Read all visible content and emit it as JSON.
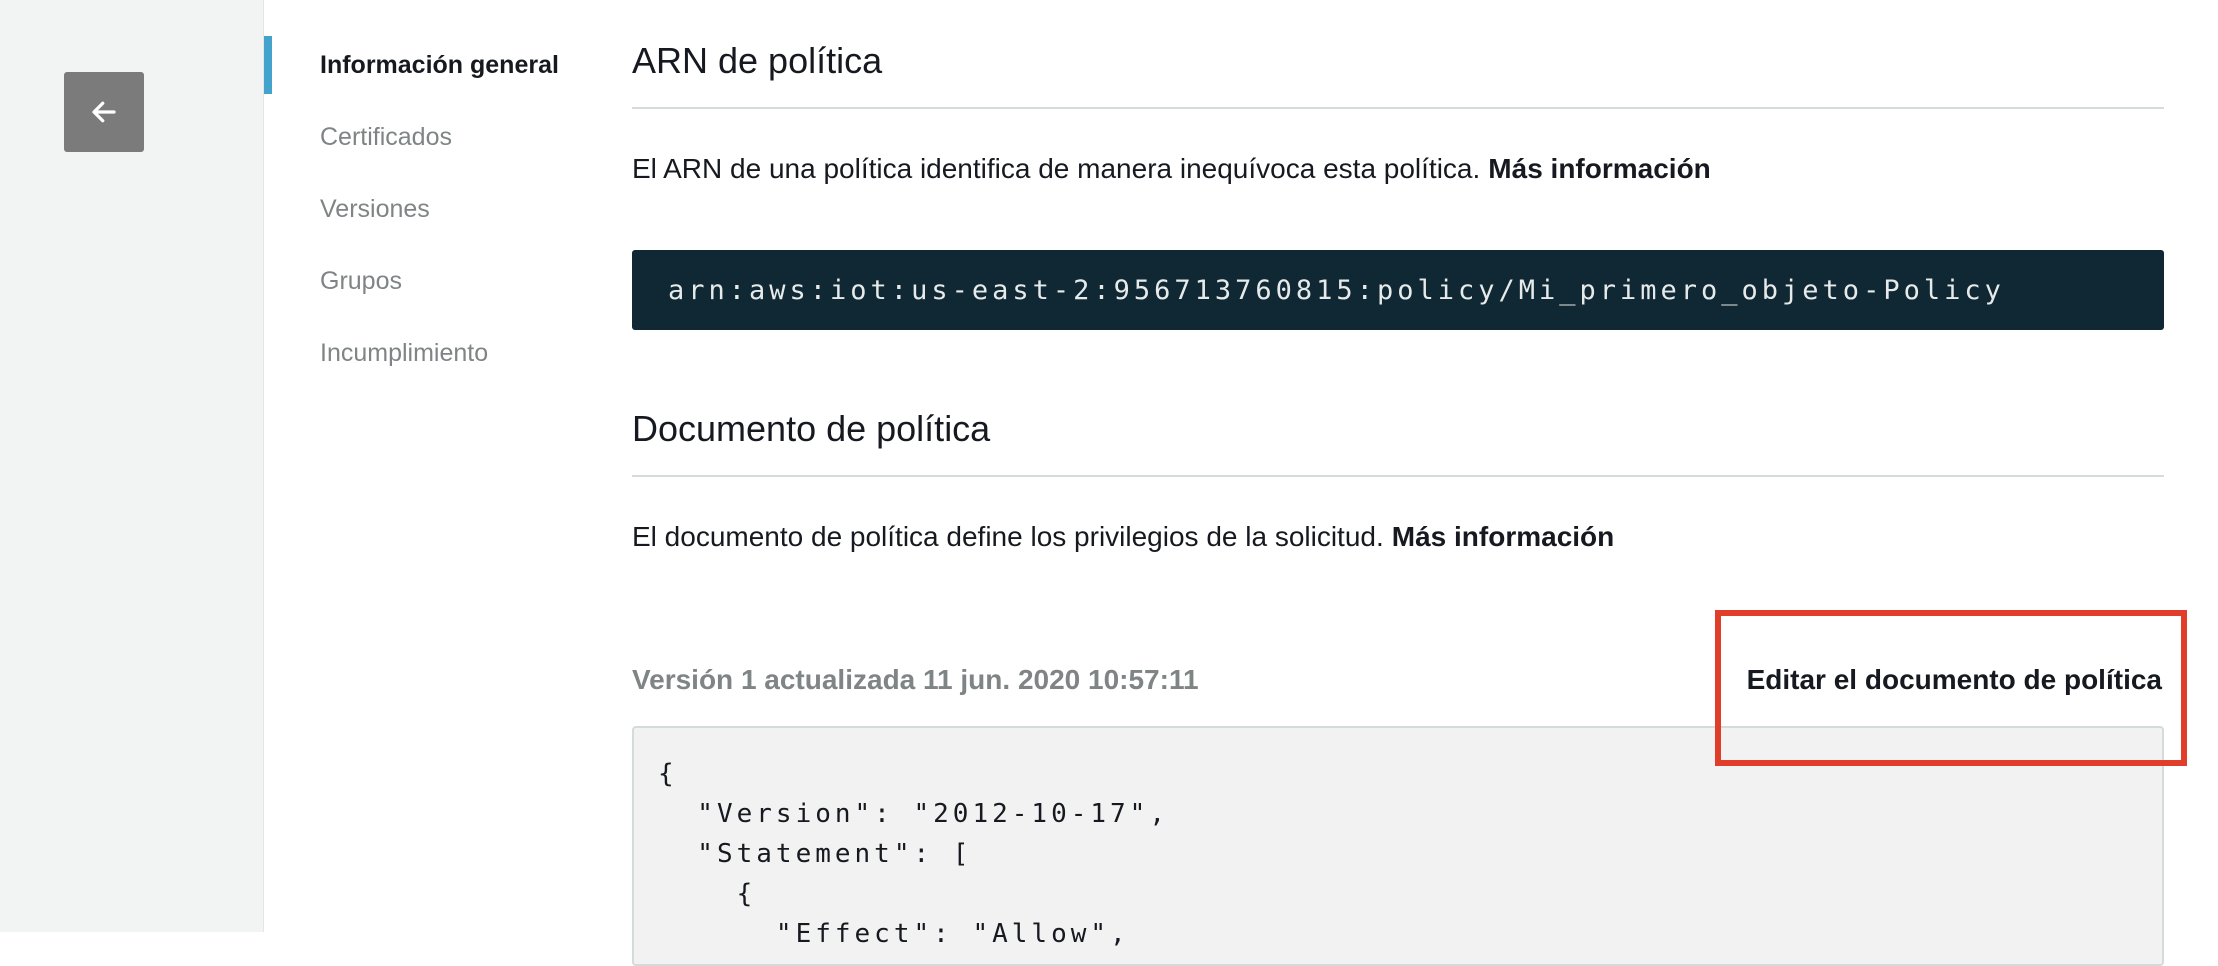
{
  "back_button": {
    "icon": "arrow-left-icon"
  },
  "nav": {
    "items": [
      {
        "label": "Información general",
        "active": true
      },
      {
        "label": "Certificados",
        "active": false
      },
      {
        "label": "Versiones",
        "active": false
      },
      {
        "label": "Grupos",
        "active": false
      },
      {
        "label": "Incumplimiento",
        "active": false
      }
    ]
  },
  "arn_section": {
    "title": "ARN de política",
    "description": "El ARN de una política identifica de manera inequívoca esta política.",
    "link": "Más información",
    "arn": "arn:aws:iot:us-east-2:956713760815:policy/Mi_primero_objeto-Policy"
  },
  "document_section": {
    "title": "Documento de política",
    "description": "El documento de política define los privilegios de la solicitud.",
    "link": "Más información",
    "version_label": "Versión 1 actualizada 11 jun. 2020 10:57:11",
    "edit_link": "Editar el documento de política",
    "code_lines": [
      "{",
      "  \"Version\": \"2012-10-17\",",
      "  \"Statement\": [",
      "    {",
      "      \"Effect\": \"Allow\","
    ]
  },
  "colors": {
    "accent": "#44a3cc",
    "arn_bg": "#0f2833",
    "highlight": "#e03d2a",
    "back_button_bg": "#7b7b7b"
  }
}
